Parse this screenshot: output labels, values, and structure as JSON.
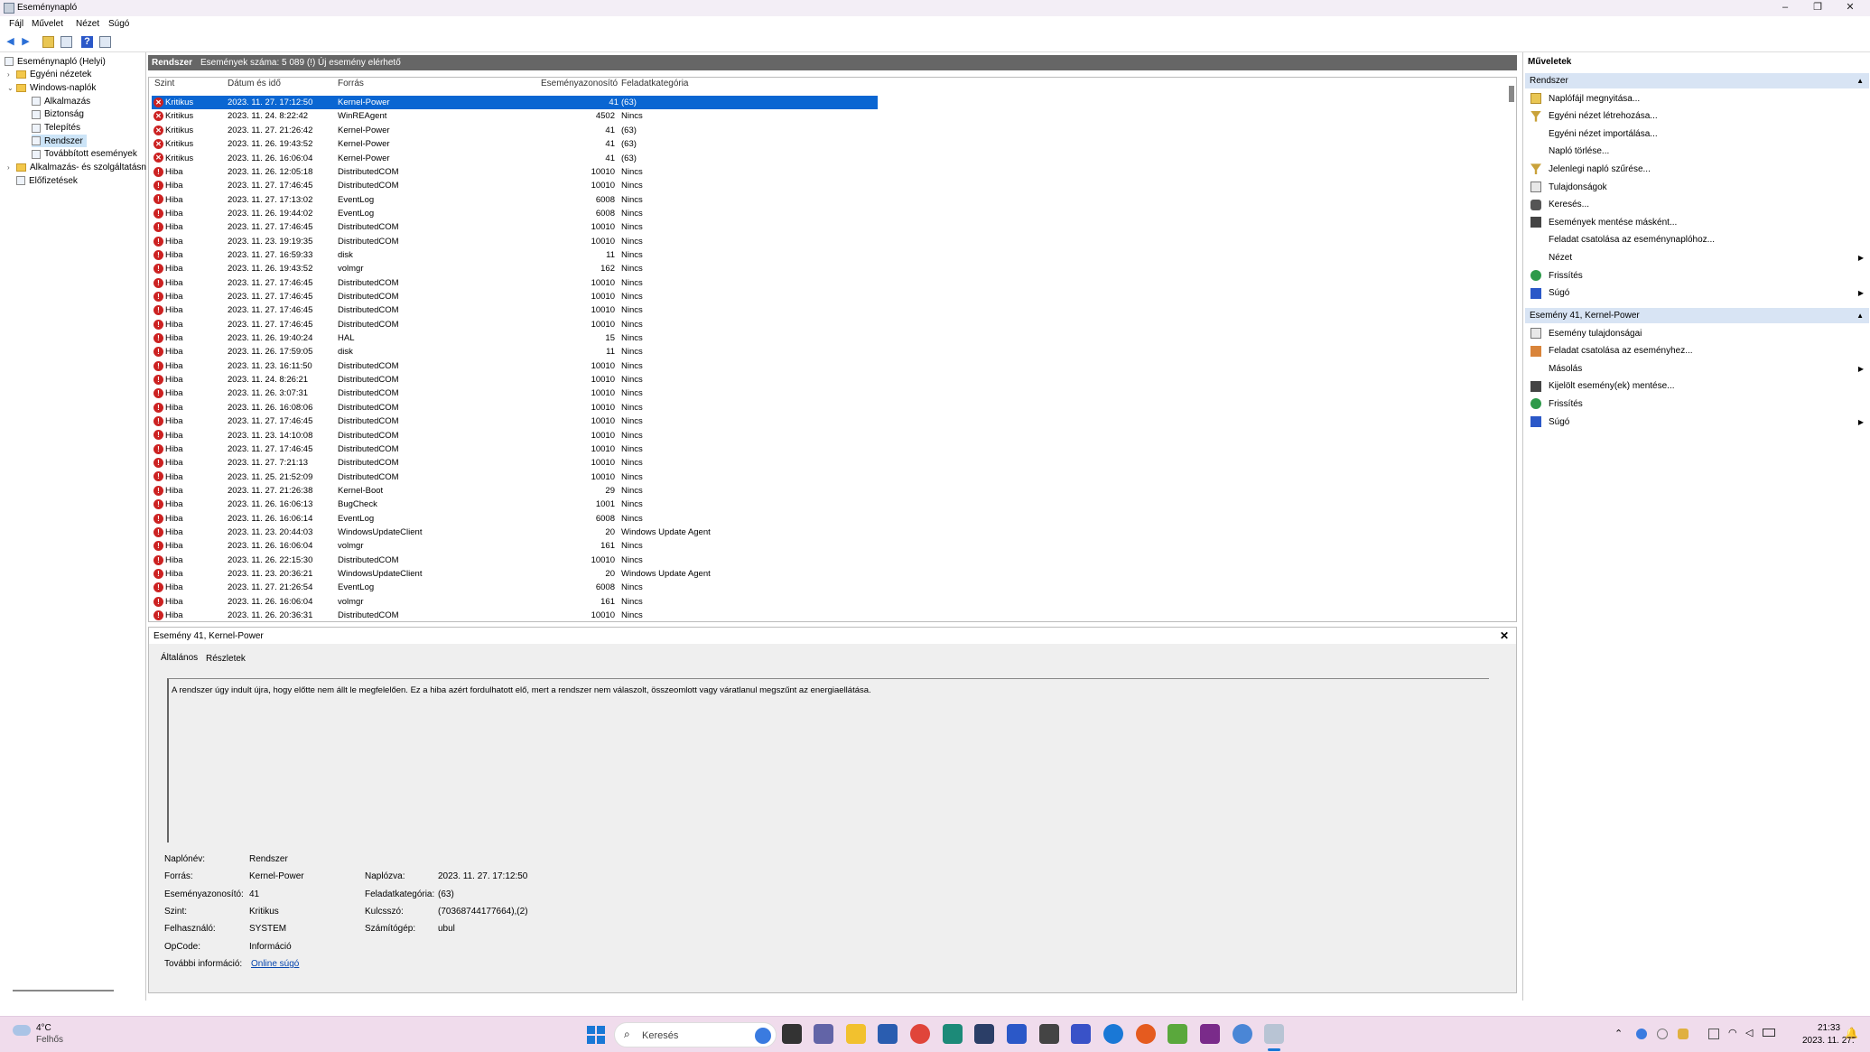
{
  "window": {
    "title": "Eseménynapló"
  },
  "menu": [
    "Fájl",
    "Művelet",
    "Nézet",
    "Súgó"
  ],
  "tree": [
    {
      "label": "Eseménynapló (Helyi)",
      "level": 0,
      "icon": "eventviewer-icon"
    },
    {
      "label": "Egyéni nézetek",
      "level": 1,
      "icon": "folder-icon",
      "exp": "›"
    },
    {
      "label": "Windows-naplók",
      "level": 1,
      "icon": "folder-icon",
      "exp": "⌄"
    },
    {
      "label": "Alkalmazás",
      "level": 2,
      "icon": "log-icon"
    },
    {
      "label": "Biztonság",
      "level": 2,
      "icon": "log-icon"
    },
    {
      "label": "Telepítés",
      "level": 2,
      "icon": "log-icon"
    },
    {
      "label": "Rendszer",
      "level": 2,
      "icon": "log-icon",
      "selected": true
    },
    {
      "label": "Továbbított események",
      "level": 2,
      "icon": "log-icon"
    },
    {
      "label": "Alkalmazás- és szolgáltatásn",
      "level": 1,
      "icon": "folder-icon",
      "exp": "›"
    },
    {
      "label": "Előfizetések",
      "level": 1,
      "icon": "log-icon"
    }
  ],
  "center_header": {
    "log": "Rendszer",
    "count": "Események száma: 5 089 (!) Új esemény elérhető"
  },
  "columns": {
    "level": "Szint",
    "date": "Dátum és idő",
    "source": "Forrás",
    "id": "Eseményazonosító",
    "task": "Feladatkategória"
  },
  "rows": [
    {
      "level": "Kritikus",
      "date": "2023. 11. 27. 17:12:50",
      "source": "Kernel-Power",
      "id": "41",
      "task": "(63)",
      "kind": "crit",
      "sel": true
    },
    {
      "level": "Kritikus",
      "date": "2023. 11. 24. 8:22:42",
      "source": "WinREAgent",
      "id": "4502",
      "task": "Nincs",
      "kind": "crit"
    },
    {
      "level": "Kritikus",
      "date": "2023. 11. 27. 21:26:42",
      "source": "Kernel-Power",
      "id": "41",
      "task": "(63)",
      "kind": "crit"
    },
    {
      "level": "Kritikus",
      "date": "2023. 11. 26. 19:43:52",
      "source": "Kernel-Power",
      "id": "41",
      "task": "(63)",
      "kind": "crit"
    },
    {
      "level": "Kritikus",
      "date": "2023. 11. 26. 16:06:04",
      "source": "Kernel-Power",
      "id": "41",
      "task": "(63)",
      "kind": "crit"
    },
    {
      "level": "Hiba",
      "date": "2023. 11. 26. 12:05:18",
      "source": "DistributedCOM",
      "id": "10010",
      "task": "Nincs",
      "kind": "err"
    },
    {
      "level": "Hiba",
      "date": "2023. 11. 27. 17:46:45",
      "source": "DistributedCOM",
      "id": "10010",
      "task": "Nincs",
      "kind": "err"
    },
    {
      "level": "Hiba",
      "date": "2023. 11. 27. 17:13:02",
      "source": "EventLog",
      "id": "6008",
      "task": "Nincs",
      "kind": "err"
    },
    {
      "level": "Hiba",
      "date": "2023. 11. 26. 19:44:02",
      "source": "EventLog",
      "id": "6008",
      "task": "Nincs",
      "kind": "err"
    },
    {
      "level": "Hiba",
      "date": "2023. 11. 27. 17:46:45",
      "source": "DistributedCOM",
      "id": "10010",
      "task": "Nincs",
      "kind": "err"
    },
    {
      "level": "Hiba",
      "date": "2023. 11. 23. 19:19:35",
      "source": "DistributedCOM",
      "id": "10010",
      "task": "Nincs",
      "kind": "err"
    },
    {
      "level": "Hiba",
      "date": "2023. 11. 27. 16:59:33",
      "source": "disk",
      "id": "11",
      "task": "Nincs",
      "kind": "err"
    },
    {
      "level": "Hiba",
      "date": "2023. 11. 26. 19:43:52",
      "source": "volmgr",
      "id": "162",
      "task": "Nincs",
      "kind": "err"
    },
    {
      "level": "Hiba",
      "date": "2023. 11. 27. 17:46:45",
      "source": "DistributedCOM",
      "id": "10010",
      "task": "Nincs",
      "kind": "err"
    },
    {
      "level": "Hiba",
      "date": "2023. 11. 27. 17:46:45",
      "source": "DistributedCOM",
      "id": "10010",
      "task": "Nincs",
      "kind": "err"
    },
    {
      "level": "Hiba",
      "date": "2023. 11. 27. 17:46:45",
      "source": "DistributedCOM",
      "id": "10010",
      "task": "Nincs",
      "kind": "err"
    },
    {
      "level": "Hiba",
      "date": "2023. 11. 27. 17:46:45",
      "source": "DistributedCOM",
      "id": "10010",
      "task": "Nincs",
      "kind": "err"
    },
    {
      "level": "Hiba",
      "date": "2023. 11. 26. 19:40:24",
      "source": "HAL",
      "id": "15",
      "task": "Nincs",
      "kind": "err"
    },
    {
      "level": "Hiba",
      "date": "2023. 11. 26. 17:59:05",
      "source": "disk",
      "id": "11",
      "task": "Nincs",
      "kind": "err"
    },
    {
      "level": "Hiba",
      "date": "2023. 11. 23. 16:11:50",
      "source": "DistributedCOM",
      "id": "10010",
      "task": "Nincs",
      "kind": "err"
    },
    {
      "level": "Hiba",
      "date": "2023. 11. 24. 8:26:21",
      "source": "DistributedCOM",
      "id": "10010",
      "task": "Nincs",
      "kind": "err"
    },
    {
      "level": "Hiba",
      "date": "2023. 11. 26. 3:07:31",
      "source": "DistributedCOM",
      "id": "10010",
      "task": "Nincs",
      "kind": "err"
    },
    {
      "level": "Hiba",
      "date": "2023. 11. 26. 16:08:06",
      "source": "DistributedCOM",
      "id": "10010",
      "task": "Nincs",
      "kind": "err"
    },
    {
      "level": "Hiba",
      "date": "2023. 11. 27. 17:46:45",
      "source": "DistributedCOM",
      "id": "10010",
      "task": "Nincs",
      "kind": "err"
    },
    {
      "level": "Hiba",
      "date": "2023. 11. 23. 14:10:08",
      "source": "DistributedCOM",
      "id": "10010",
      "task": "Nincs",
      "kind": "err"
    },
    {
      "level": "Hiba",
      "date": "2023. 11. 27. 17:46:45",
      "source": "DistributedCOM",
      "id": "10010",
      "task": "Nincs",
      "kind": "err"
    },
    {
      "level": "Hiba",
      "date": "2023. 11. 27. 7:21:13",
      "source": "DistributedCOM",
      "id": "10010",
      "task": "Nincs",
      "kind": "err"
    },
    {
      "level": "Hiba",
      "date": "2023. 11. 25. 21:52:09",
      "source": "DistributedCOM",
      "id": "10010",
      "task": "Nincs",
      "kind": "err"
    },
    {
      "level": "Hiba",
      "date": "2023. 11. 27. 21:26:38",
      "source": "Kernel-Boot",
      "id": "29",
      "task": "Nincs",
      "kind": "err"
    },
    {
      "level": "Hiba",
      "date": "2023. 11. 26. 16:06:13",
      "source": "BugCheck",
      "id": "1001",
      "task": "Nincs",
      "kind": "err"
    },
    {
      "level": "Hiba",
      "date": "2023. 11. 26. 16:06:14",
      "source": "EventLog",
      "id": "6008",
      "task": "Nincs",
      "kind": "err"
    },
    {
      "level": "Hiba",
      "date": "2023. 11. 23. 20:44:03",
      "source": "WindowsUpdateClient",
      "id": "20",
      "task": "Windows Update Agent",
      "kind": "err"
    },
    {
      "level": "Hiba",
      "date": "2023. 11. 26. 16:06:04",
      "source": "volmgr",
      "id": "161",
      "task": "Nincs",
      "kind": "err"
    },
    {
      "level": "Hiba",
      "date": "2023. 11. 26. 22:15:30",
      "source": "DistributedCOM",
      "id": "10010",
      "task": "Nincs",
      "kind": "err"
    },
    {
      "level": "Hiba",
      "date": "2023. 11. 23. 20:36:21",
      "source": "WindowsUpdateClient",
      "id": "20",
      "task": "Windows Update Agent",
      "kind": "err"
    },
    {
      "level": "Hiba",
      "date": "2023. 11. 27. 21:26:54",
      "source": "EventLog",
      "id": "6008",
      "task": "Nincs",
      "kind": "err"
    },
    {
      "level": "Hiba",
      "date": "2023. 11. 26. 16:06:04",
      "source": "volmgr",
      "id": "161",
      "task": "Nincs",
      "kind": "err"
    },
    {
      "level": "Hiba",
      "date": "2023. 11. 26. 20:36:31",
      "source": "DistributedCOM",
      "id": "10010",
      "task": "Nincs",
      "kind": "err"
    }
  ],
  "detail": {
    "title": "Esemény 41, Kernel-Power",
    "tabs": [
      "Általános",
      "Részletek"
    ],
    "message": "A rendszer úgy indult újra, hogy előtte nem állt le megfelelően. Ez a hiba azért fordulhatott elő, mert a rendszer nem válaszolt, összeomlott vagy váratlanul megszűnt az energiaellátása.",
    "fields": {
      "lognev_label": "Naplónév:",
      "lognev": "Rendszer",
      "forras_label": "Forrás:",
      "forras": "Kernel-Power",
      "azon_label": "Eseményazonosító:",
      "azon": "41",
      "szint_label": "Szint:",
      "szint": "Kritikus",
      "felh_label": "Felhasználó:",
      "felh": "SYSTEM",
      "opcode_label": "OpCode:",
      "opcode": "Információ",
      "tovabbi_label": "További információ:",
      "tovabbi": "Online súgó",
      "naplozva_label": "Naplózva:",
      "naplozva": "2023. 11. 27. 17:12:50",
      "feladat_label": "Feladatkategória:",
      "feladat": "(63)",
      "kulcsszo_label": "Kulcsszó:",
      "kulcsszo": "(70368744177664),(2)",
      "szamitogep_label": "Számítógép:",
      "szamitogep": "ubul"
    }
  },
  "actions": {
    "title": "Műveletek",
    "section1": "Rendszer",
    "items1": [
      {
        "label": "Naplófájl megnyitása...",
        "icon": "folder-open-icon"
      },
      {
        "label": "Egyéni nézet létrehozása...",
        "icon": "filter-icon"
      },
      {
        "label": "Egyéni nézet importálása...",
        "icon": ""
      },
      {
        "label": "Napló törlése...",
        "icon": ""
      },
      {
        "label": "Jelenlegi napló szűrése...",
        "icon": "filter-icon"
      },
      {
        "label": "Tulajdonságok",
        "icon": "properties-icon"
      },
      {
        "label": "Keresés...",
        "icon": "binoculars-icon"
      },
      {
        "label": "Események mentése másként...",
        "icon": "save-icon"
      },
      {
        "label": "Feladat csatolása az eseménynaplóhoz...",
        "icon": ""
      },
      {
        "label": "Nézet",
        "icon": "",
        "sub": true
      },
      {
        "label": "Frissítés",
        "icon": "refresh-icon"
      },
      {
        "label": "Súgó",
        "icon": "help-icon",
        "sub": true
      }
    ],
    "section2": "Esemény 41, Kernel-Power",
    "items2": [
      {
        "label": "Esemény tulajdonságai",
        "icon": "properties-icon"
      },
      {
        "label": "Feladat csatolása az eseményhez...",
        "icon": "task-icon"
      },
      {
        "label": "Másolás",
        "icon": "copy-icon",
        "sub": true
      },
      {
        "label": "Kijelölt esemény(ek) mentése...",
        "icon": "save-icon"
      },
      {
        "label": "Frissítés",
        "icon": "refresh-icon"
      },
      {
        "label": "Súgó",
        "icon": "help-icon",
        "sub": true
      }
    ]
  },
  "taskbar": {
    "weather_temp": "4°C",
    "weather_desc": "Felhős",
    "search_placeholder": "Keresés",
    "time": "21:33",
    "date": "2023. 11. 27."
  }
}
